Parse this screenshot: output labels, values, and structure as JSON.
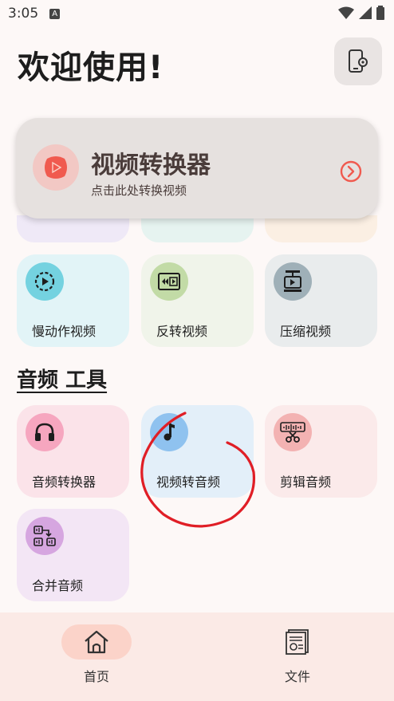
{
  "status_bar": {
    "time": "3:05",
    "notification_badge": "A"
  },
  "header": {
    "title": "欢迎使用!"
  },
  "hero": {
    "title": "视频转换器",
    "subtitle": "点击此处转换视频"
  },
  "video_tools": [
    {
      "label": "慢动作视频",
      "icon": "slow-motion-icon",
      "bg": "#e2f4f7",
      "icon_bg": "#74d2e0"
    },
    {
      "label": "反转视频",
      "icon": "reverse-video-icon",
      "bg": "#f0f4ea",
      "icon_bg": "#c2dba6"
    },
    {
      "label": "压缩视频",
      "icon": "compress-video-icon",
      "bg": "#e9eced",
      "icon_bg": "#9fb0b8"
    }
  ],
  "audio_section": {
    "title": "音频 工具"
  },
  "audio_tools": [
    {
      "label": "音频转换器",
      "icon": "headphones-icon",
      "bg": "#fbe3e9",
      "icon_bg": "#f6a6bf"
    },
    {
      "label": "视频转音频",
      "icon": "music-note-icon",
      "bg": "#e3eff9",
      "icon_bg": "#8fc2ef"
    },
    {
      "label": "剪辑音频",
      "icon": "cut-audio-icon",
      "bg": "#fbeaea",
      "icon_bg": "#f3b2b2"
    },
    {
      "label": "合并音频",
      "icon": "merge-audio-icon",
      "bg": "#f3e6f5",
      "icon_bg": "#d6a6e0"
    }
  ],
  "bottom_nav": {
    "items": [
      {
        "label": "首页",
        "icon": "home-icon",
        "active": true
      },
      {
        "label": "文件",
        "icon": "files-icon",
        "active": false
      }
    ]
  },
  "colors": {
    "accent": "#f05a4f",
    "annotation": "#e01e26"
  }
}
